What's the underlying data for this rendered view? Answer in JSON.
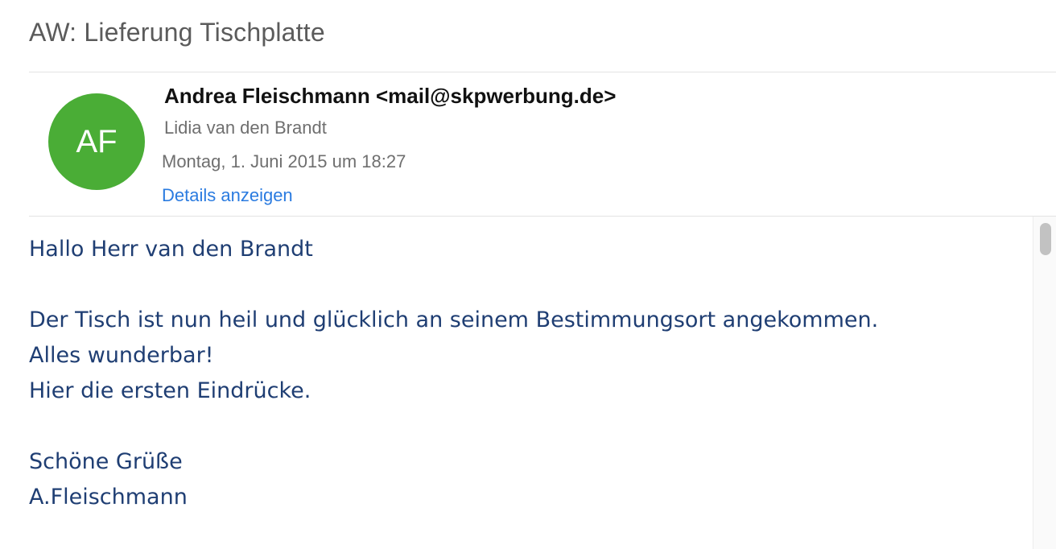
{
  "email": {
    "subject": "AW: Lieferung Tischplatte",
    "avatar_initials": "AF",
    "avatar_color": "#4aad36",
    "sender": "Andrea Fleischmann <mail@skpwerbung.de>",
    "recipient": "Lidia van den Brandt",
    "date": "Montag, 1. Juni 2015 um 18:27",
    "details_link": "Details anzeigen",
    "link_color": "#2a7be0",
    "body_color": "#1f3e73",
    "body_lines": [
      "Hallo Herr van den Brandt",
      "",
      "Der Tisch ist nun heil und glücklich an seinem Bestimmungsort angekommen.",
      "Alles wunderbar!",
      "Hier die ersten Eindrücke.",
      "",
      "Schöne Grüße",
      "A.Fleischmann"
    ]
  }
}
